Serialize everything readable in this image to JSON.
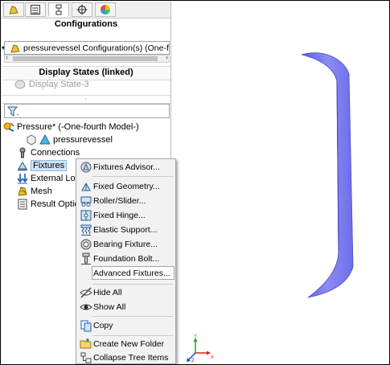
{
  "panel": {
    "title": "Configurations",
    "config_combo": "pressurevessel Configuration(s)  (One-fourt",
    "display_states_heading": "Display States (linked)",
    "display_state": "Display State-3",
    "tree": {
      "root": "Pressure* (-One-fourth Model-)",
      "items": [
        {
          "label": "pressurevessel",
          "icon": "part-icon"
        },
        {
          "label": "Connections",
          "icon": "connections-icon"
        },
        {
          "label": "Fixtures",
          "icon": "fixtures-icon"
        },
        {
          "label": "External Loads",
          "icon": "external-loads-icon"
        },
        {
          "label": "Mesh",
          "icon": "mesh-icon"
        },
        {
          "label": "Result Options",
          "icon": "result-options-icon"
        }
      ]
    }
  },
  "menu": {
    "items": [
      {
        "label": "Fixtures Advisor...",
        "icon": "fixtures-advisor-icon"
      },
      {
        "label": "Fixed Geometry...",
        "icon": "fixed-geometry-icon"
      },
      {
        "label": "Roller/Slider...",
        "icon": "roller-slider-icon"
      },
      {
        "label": "Fixed Hinge...",
        "icon": "fixed-hinge-icon"
      },
      {
        "label": "Elastic Support...",
        "icon": "elastic-support-icon"
      },
      {
        "label": "Bearing Fixture...",
        "icon": "bearing-fixture-icon"
      },
      {
        "label": "Foundation Bolt...",
        "icon": "foundation-bolt-icon"
      },
      {
        "label": "Advanced Fixtures...",
        "icon": ""
      },
      {
        "label": "Hide All",
        "icon": "hide-icon"
      },
      {
        "label": "Show All",
        "icon": "show-icon"
      },
      {
        "label": "Copy",
        "icon": "copy-icon"
      },
      {
        "label": "Create New Folder",
        "icon": "new-folder-icon"
      },
      {
        "label": "Collapse Tree Items",
        "icon": "collapse-tree-icon"
      }
    ]
  },
  "viewport": {
    "triad": {
      "y": "Y",
      "x": "X",
      "z": "Z"
    },
    "model_color": "#7b7cf0"
  }
}
